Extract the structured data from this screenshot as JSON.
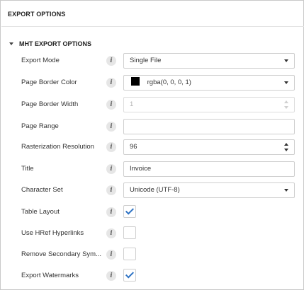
{
  "panel": {
    "title": "EXPORT OPTIONS"
  },
  "group": {
    "title": "MHT EXPORT OPTIONS",
    "expanded": true
  },
  "fields": {
    "export_mode": {
      "label": "Export Mode",
      "value": "Single File"
    },
    "page_border_color": {
      "label": "Page Border Color",
      "value": "rgba(0, 0, 0, 1)",
      "swatch": "#000000"
    },
    "page_border_width": {
      "label": "Page Border Width",
      "value": "1",
      "disabled": true
    },
    "page_range": {
      "label": "Page Range",
      "value": ""
    },
    "rasterization_resolution": {
      "label": "Rasterization Resolution",
      "value": "96"
    },
    "title": {
      "label": "Title",
      "value": "Invoice"
    },
    "character_set": {
      "label": "Character Set",
      "value": "Unicode (UTF-8)"
    },
    "table_layout": {
      "label": "Table Layout",
      "checked": true
    },
    "use_href_hyperlinks": {
      "label": "Use HRef Hyperlinks",
      "checked": false
    },
    "remove_secondary_symbols": {
      "label": "Remove Secondary Sym...",
      "checked": false
    },
    "export_watermarks": {
      "label": "Export Watermarks",
      "checked": true
    }
  },
  "info_glyph": "i",
  "colors": {
    "check": "#2d72c4",
    "border": "#cfcfcf"
  }
}
